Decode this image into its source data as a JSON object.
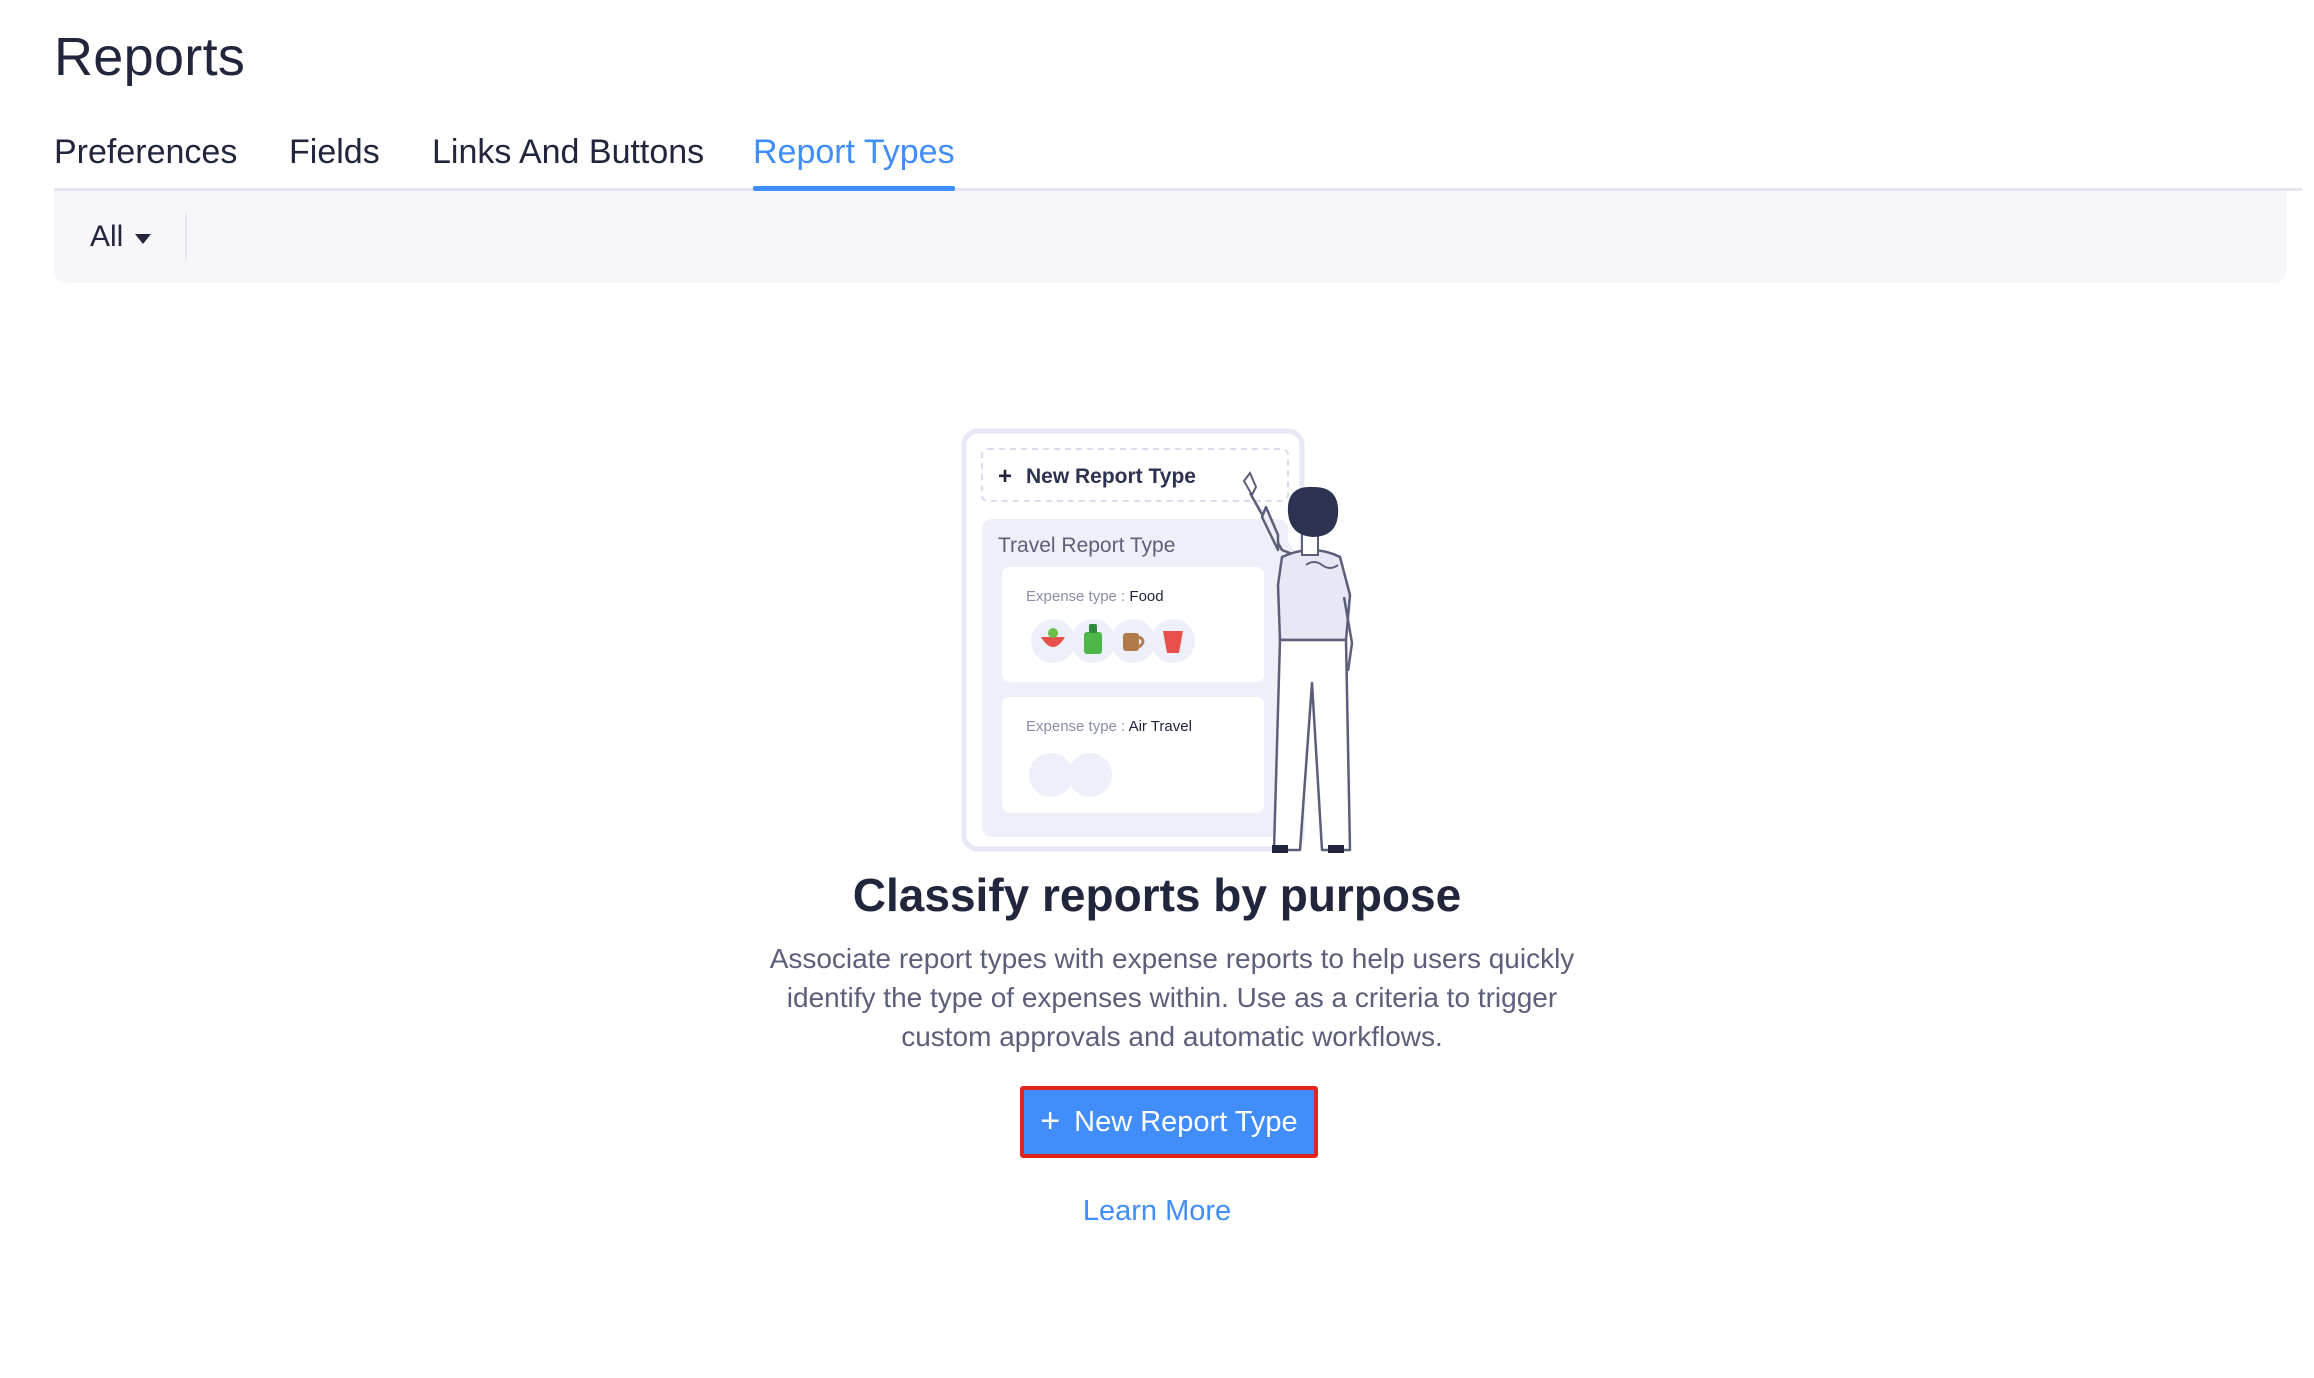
{
  "page": {
    "title": "Reports"
  },
  "tabs": [
    {
      "label": "Preferences",
      "active": false
    },
    {
      "label": "Fields",
      "active": false
    },
    {
      "label": "Links And Buttons",
      "active": false
    },
    {
      "label": "Report Types",
      "active": true
    }
  ],
  "filter": {
    "selected": "All",
    "icon": "caret-down-icon"
  },
  "illustration": {
    "new_button_label": "New Report Type",
    "card_title": "Travel Report Type",
    "expense_food": {
      "prefix": "Expense type : ",
      "value": "Food"
    },
    "expense_air": {
      "prefix": "Expense type : ",
      "value": "Air Travel"
    },
    "food_icons": [
      "salad-bowl-icon",
      "bottle-icon",
      "coffee-cup-icon",
      "drink-cup-icon"
    ]
  },
  "empty_state": {
    "heading": "Classify reports by purpose",
    "description": "Associate report types with expense reports to help users quickly identify the type of expenses within. Use as a criteria to trigger custom approvals and automatic workflows.",
    "primary_button": {
      "icon": "plus-icon",
      "label": "New Report Type"
    },
    "learn_more": "Learn More"
  },
  "colors": {
    "accent": "#408dfb",
    "text": "#21263c",
    "muted_text": "#5c5f7a",
    "filter_bg": "#f7f7fb",
    "highlight_border": "#e1251b"
  }
}
